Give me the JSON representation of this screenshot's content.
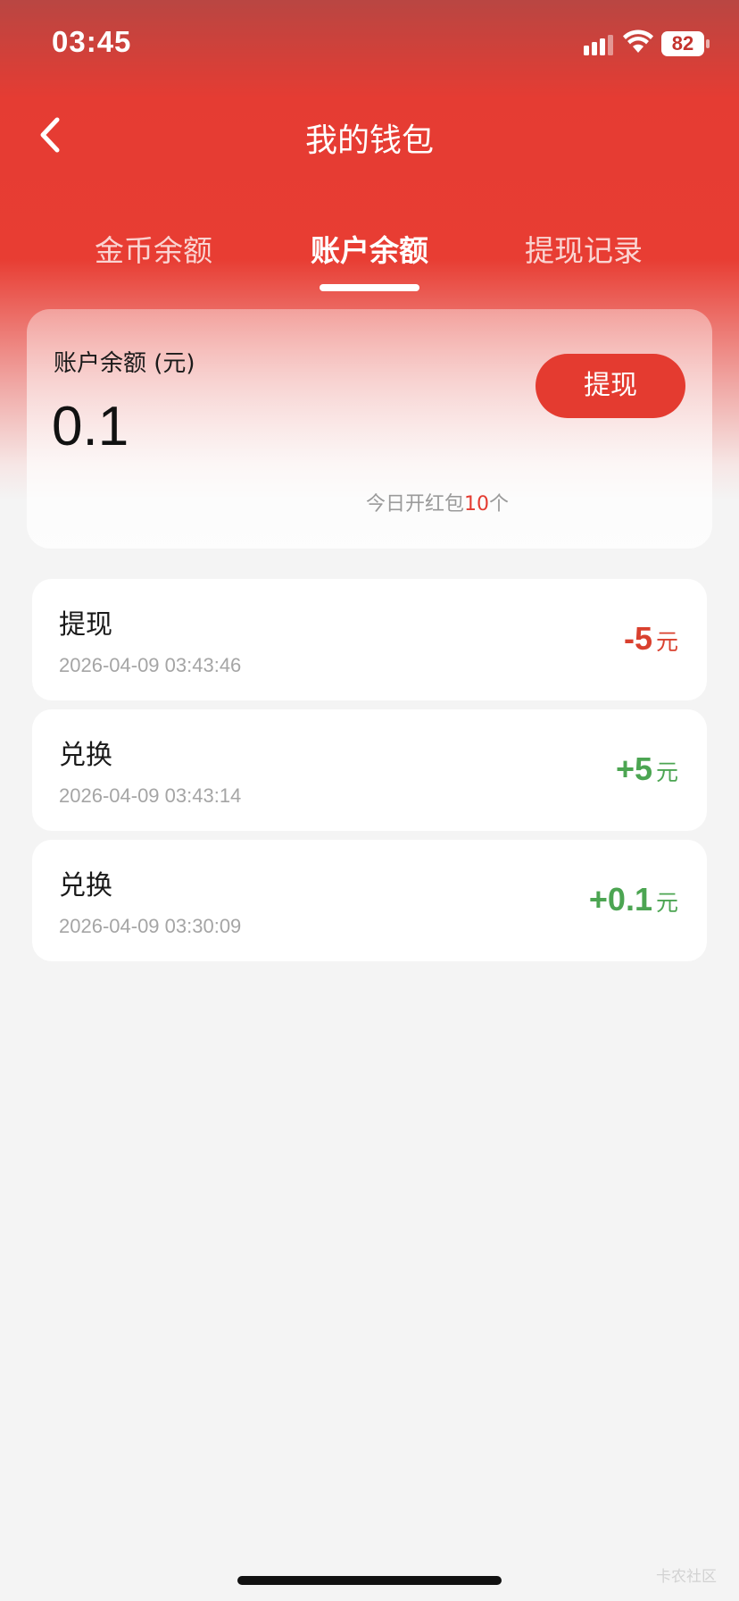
{
  "status_bar": {
    "time": "03:45",
    "battery": "82",
    "icons": [
      "signal-icon",
      "wifi-icon",
      "battery-icon"
    ]
  },
  "header": {
    "title": "我的钱包",
    "back_icon": "chevron-left-icon"
  },
  "tabs": [
    {
      "label": "金币余额",
      "active": false
    },
    {
      "label": "账户余额",
      "active": true
    },
    {
      "label": "提现记录",
      "active": false
    }
  ],
  "balance": {
    "label": "账户余额 (元)",
    "value": "0.1",
    "withdraw_label": "提现",
    "today_prefix": "今日开红包",
    "today_count": "10",
    "today_suffix": "个"
  },
  "records": [
    {
      "title": "提现",
      "time": "2026-04-09 03:43:46",
      "amount": "-5",
      "unit": "元",
      "type": "negative"
    },
    {
      "title": "兑换",
      "time": "2026-04-09 03:43:14",
      "amount": "+5",
      "unit": "元",
      "type": "positive"
    },
    {
      "title": "兑换",
      "time": "2026-04-09 03:30:09",
      "amount": "+0.1",
      "unit": "元",
      "type": "positive"
    }
  ],
  "colors": {
    "primary_red": "#e43b30",
    "negative": "#d9402e",
    "positive": "#4ca552"
  },
  "watermark": "卡农社区"
}
